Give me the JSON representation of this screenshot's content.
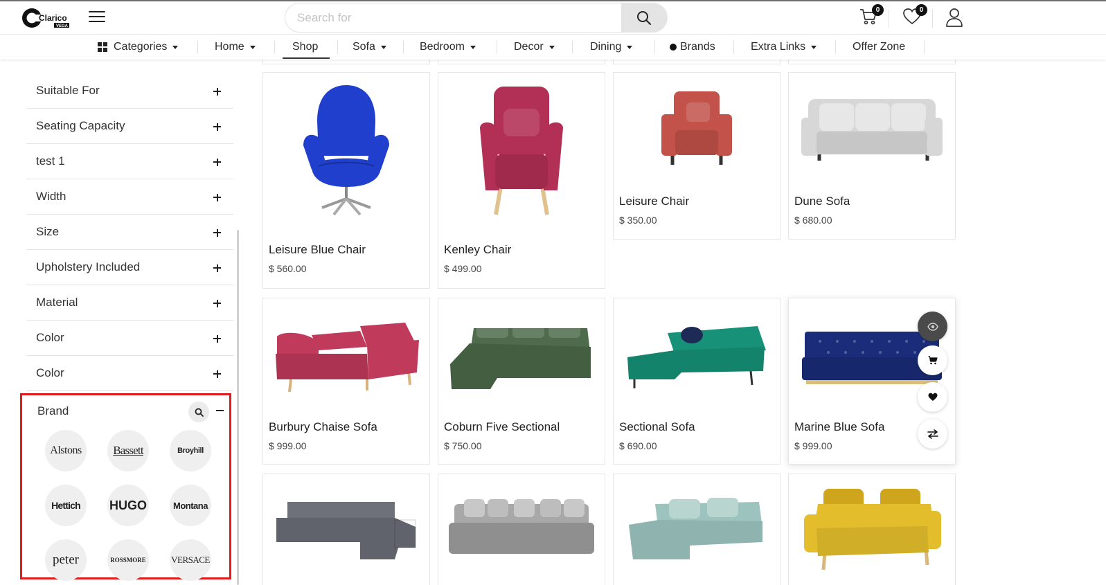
{
  "header": {
    "logo_text": "Clarico",
    "logo_sub": "VEGA",
    "search_placeholder": "Search for",
    "cart_count": "0",
    "wishlist_count": "0"
  },
  "nav": {
    "items": [
      {
        "label": "Categories"
      },
      {
        "label": "Home"
      },
      {
        "label": "Shop"
      },
      {
        "label": "Sofa"
      },
      {
        "label": "Bedroom"
      },
      {
        "label": "Decor"
      },
      {
        "label": "Dining"
      },
      {
        "label": "Brands"
      },
      {
        "label": "Extra Links"
      },
      {
        "label": "Offer Zone"
      }
    ],
    "active": "Shop"
  },
  "sidebar": {
    "filters": [
      {
        "label": "Suitable For"
      },
      {
        "label": "Seating Capacity"
      },
      {
        "label": "test 1"
      },
      {
        "label": "Width"
      },
      {
        "label": "Size"
      },
      {
        "label": "Upholstery Included"
      },
      {
        "label": "Material"
      },
      {
        "label": "Color"
      },
      {
        "label": "Color"
      }
    ],
    "brand": {
      "title": "Brand",
      "logos": [
        {
          "name": "Alstons"
        },
        {
          "name": "Bassett"
        },
        {
          "name": "Broyhill"
        },
        {
          "name": "Hettich"
        },
        {
          "name": "HUGO"
        },
        {
          "name": "Montana"
        },
        {
          "name": "peter"
        },
        {
          "name": "ROSSMORE"
        },
        {
          "name": "VERSACE"
        }
      ]
    }
  },
  "products": [
    {
      "name": "Leisure Blue Chair",
      "price": "$ 560.00",
      "color": "#1f3fcc"
    },
    {
      "name": "Kenley Chair",
      "price": "$ 499.00",
      "color": "#b22f55"
    },
    {
      "name": "Leisure Chair",
      "price": "$ 350.00",
      "color": "#c2524a"
    },
    {
      "name": "Dune Sofa",
      "price": "$ 680.00",
      "color": "#d7d7d7"
    },
    {
      "name": "Burbury Chaise Sofa",
      "price": "$ 999.00",
      "color": "#c03a5c"
    },
    {
      "name": "Coburn Five Sectional",
      "price": "$ 750.00",
      "color": "#4e6b4c"
    },
    {
      "name": "Sectional Sofa",
      "price": "$ 690.00",
      "color": "#179279"
    },
    {
      "name": "Marine Blue Sofa",
      "price": "$ 999.00",
      "color": "#1b2d7a"
    },
    {
      "name": "",
      "price": "",
      "color": "#6e717a"
    },
    {
      "name": "",
      "price": "",
      "color": "#a8a8a8"
    },
    {
      "name": "",
      "price": "",
      "color": "#9cc3bd"
    },
    {
      "name": "",
      "price": "",
      "color": "#e3bd2b"
    }
  ]
}
